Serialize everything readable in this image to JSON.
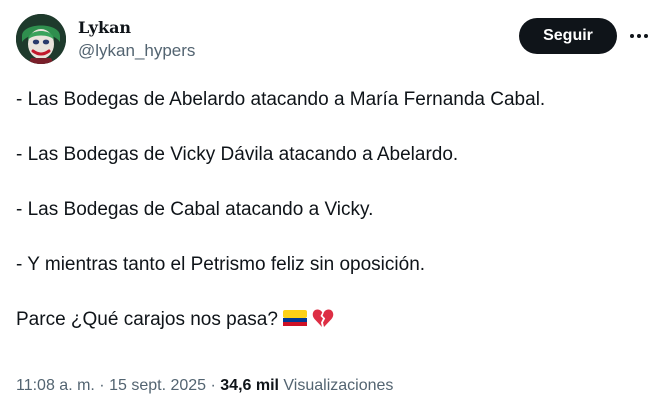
{
  "author": {
    "display_name": "Lykan",
    "handle": "@lykan_hypers",
    "avatar_icon": "joker-avatar"
  },
  "actions": {
    "follow_label": "Seguir",
    "more_icon": "more-horizontal-icon"
  },
  "tweet": {
    "lines": [
      "- Las Bodegas de Abelardo atacando a María Fernanda Cabal.",
      "- Las Bodegas de Vicky Dávila atacando a Abelardo.",
      "- Las Bodegas de Cabal atacando a Vicky.",
      "- Y mientras tanto el Petrismo feliz sin oposición.",
      "Parce ¿Qué carajos nos pasa?"
    ],
    "emojis": [
      "colombia-flag-icon",
      "broken-heart-icon"
    ]
  },
  "meta": {
    "time": "11:08 a. m.",
    "separator": " · ",
    "date": "15 sept. 2025",
    "views_count": "34,6 mil",
    "views_label": "Visualizaciones"
  },
  "colors": {
    "text": "#0f1419",
    "secondary": "#536471",
    "button_bg": "#0f1419",
    "button_text": "#ffffff"
  }
}
